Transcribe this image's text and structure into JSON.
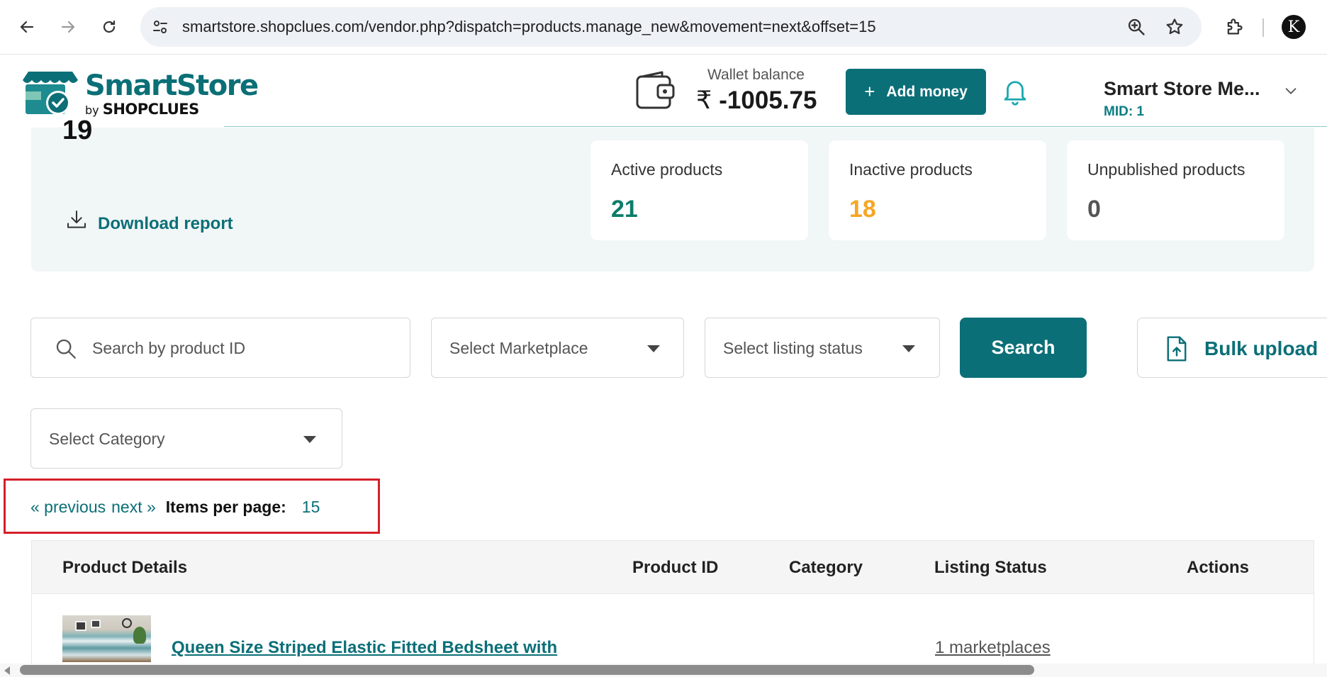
{
  "browser": {
    "url": "smartstore.shopclues.com/vendor.php?dispatch=products.manage_new&movement=next&offset=15",
    "profile_initial": "K"
  },
  "header": {
    "logo_main": "SmartStore",
    "logo_by": "by",
    "logo_brand": "SHOPCLUES",
    "wallet_label": "Wallet balance",
    "wallet_currency": "₹",
    "wallet_amount": "-1005.75",
    "add_money_label": "Add money",
    "store_name": "Smart Store Me...",
    "store_mid": "MID: 1"
  },
  "summary": {
    "total": "19",
    "download_label": "Download report",
    "cards": [
      {
        "label": "Active products",
        "value": "21",
        "color": "#0b7d6a"
      },
      {
        "label": "Inactive products",
        "value": "18",
        "color": "#f5a623"
      },
      {
        "label": "Unpublished products",
        "value": "0",
        "color": "#555555"
      }
    ]
  },
  "filters": {
    "search_placeholder": "Search by product ID",
    "marketplace_placeholder": "Select Marketplace",
    "listing_status_placeholder": "Select listing status",
    "search_button": "Search",
    "bulk_upload": "Bulk upload",
    "category_placeholder": "Select Category"
  },
  "pagination": {
    "previous": "« previous",
    "next": "next »",
    "items_per_page_label": "Items per page:",
    "items_per_page_value": "15"
  },
  "table": {
    "headers": [
      "Product Details",
      "Product ID",
      "Category",
      "Listing Status",
      "Actions"
    ],
    "rows": [
      {
        "product_name": "Queen Size Striped Elastic Fitted Bedsheet with",
        "listing_status": "1 marketplaces"
      }
    ]
  },
  "colors": {
    "accent": "#0b6f77",
    "highlight_border": "#d4202a"
  }
}
